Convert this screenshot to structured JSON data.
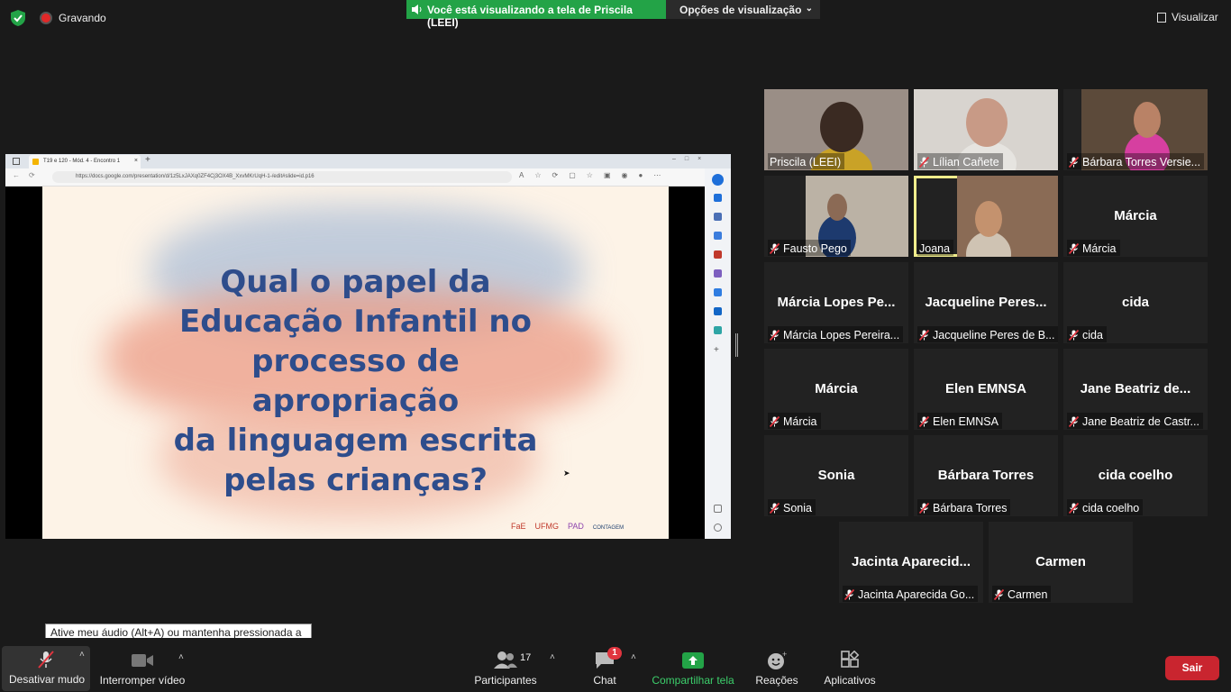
{
  "top_bar": {
    "recording_label": "Gravando",
    "share_banner_text": "Você está visualizando a tela de Priscila (LEEI)",
    "view_options_label": "Opções de visualização",
    "view_button_label": "Visualizar"
  },
  "shared_screen": {
    "browser_tab_title": "T19 e 120 - Mód. 4 - Encontro 1",
    "browser_url": "https://docs.google.com/presentation/d/1z5LxJAXq0ZF4Cj3OX4B_XxvMKrUqH-1-/edit#slide=id.p16",
    "slide_title_lines": [
      "Qual o papel da",
      "Educação Infantil no",
      "processo de apropriação",
      "da linguagem escrita",
      "pelas crianças?"
    ],
    "slide_logos": [
      "FaE",
      "UFMG",
      "PAD",
      "CONTAGEM"
    ]
  },
  "gallery": [
    {
      "display": "",
      "name": "Priscila (LEEI)",
      "muted": false,
      "video": true,
      "active": false
    },
    {
      "display": "",
      "name": "Lílian Cañete",
      "muted": true,
      "video": true,
      "active": false
    },
    {
      "display": "",
      "name": "Bárbara Torres Versie...",
      "muted": true,
      "video": true,
      "active": false
    },
    {
      "display": "",
      "name": "Fausto Pego",
      "muted": true,
      "video": true,
      "active": false
    },
    {
      "display": "",
      "name": "Joana",
      "muted": false,
      "video": true,
      "active": true
    },
    {
      "display": "Márcia",
      "name": "Márcia",
      "muted": true,
      "video": false,
      "active": false
    },
    {
      "display": "Márcia Lopes Pe...",
      "name": "Márcia Lopes Pereira...",
      "muted": true,
      "video": false,
      "active": false
    },
    {
      "display": "Jacqueline Peres...",
      "name": "Jacqueline Peres de B...",
      "muted": true,
      "video": false,
      "active": false
    },
    {
      "display": "cida",
      "name": "cida",
      "muted": true,
      "video": false,
      "active": false
    },
    {
      "display": "Márcia",
      "name": "Márcia",
      "muted": true,
      "video": false,
      "active": false
    },
    {
      "display": "Elen EMNSA",
      "name": "Elen EMNSA",
      "muted": true,
      "video": false,
      "active": false
    },
    {
      "display": "Jane Beatriz de...",
      "name": "Jane Beatriz de Castr...",
      "muted": true,
      "video": false,
      "active": false
    },
    {
      "display": "Sonia",
      "name": "Sonia",
      "muted": true,
      "video": false,
      "active": false
    },
    {
      "display": "Bárbara Torres",
      "name": "Bárbara Torres",
      "muted": true,
      "video": false,
      "active": false
    },
    {
      "display": "cida coelho",
      "name": "cida coelho",
      "muted": true,
      "video": false,
      "active": false
    },
    {
      "display": "Jacinta Aparecid...",
      "name": "Jacinta Aparecida Go...",
      "muted": true,
      "video": false,
      "active": false
    },
    {
      "display": "Carmen",
      "name": "Carmen",
      "muted": true,
      "video": false,
      "active": false
    }
  ],
  "toolbar": {
    "mute_label": "Desativar mudo",
    "video_label": "Interromper vídeo",
    "participants_label": "Participantes",
    "participants_count": "17",
    "chat_label": "Chat",
    "chat_badge": "1",
    "share_label": "Compartilhar tela",
    "reactions_label": "Reações",
    "apps_label": "Aplicativos",
    "leave_label": "Sair",
    "tooltip": "Ative meu áudio (Alt+A) ou mantenha pressionada a barra de espaço para ativar o áudio temporariamente."
  },
  "colors": {
    "share_green": "#23a347",
    "leave_red": "#c9252f",
    "active_speaker": "#f0ed8c",
    "slide_title": "#2e4d8c"
  }
}
